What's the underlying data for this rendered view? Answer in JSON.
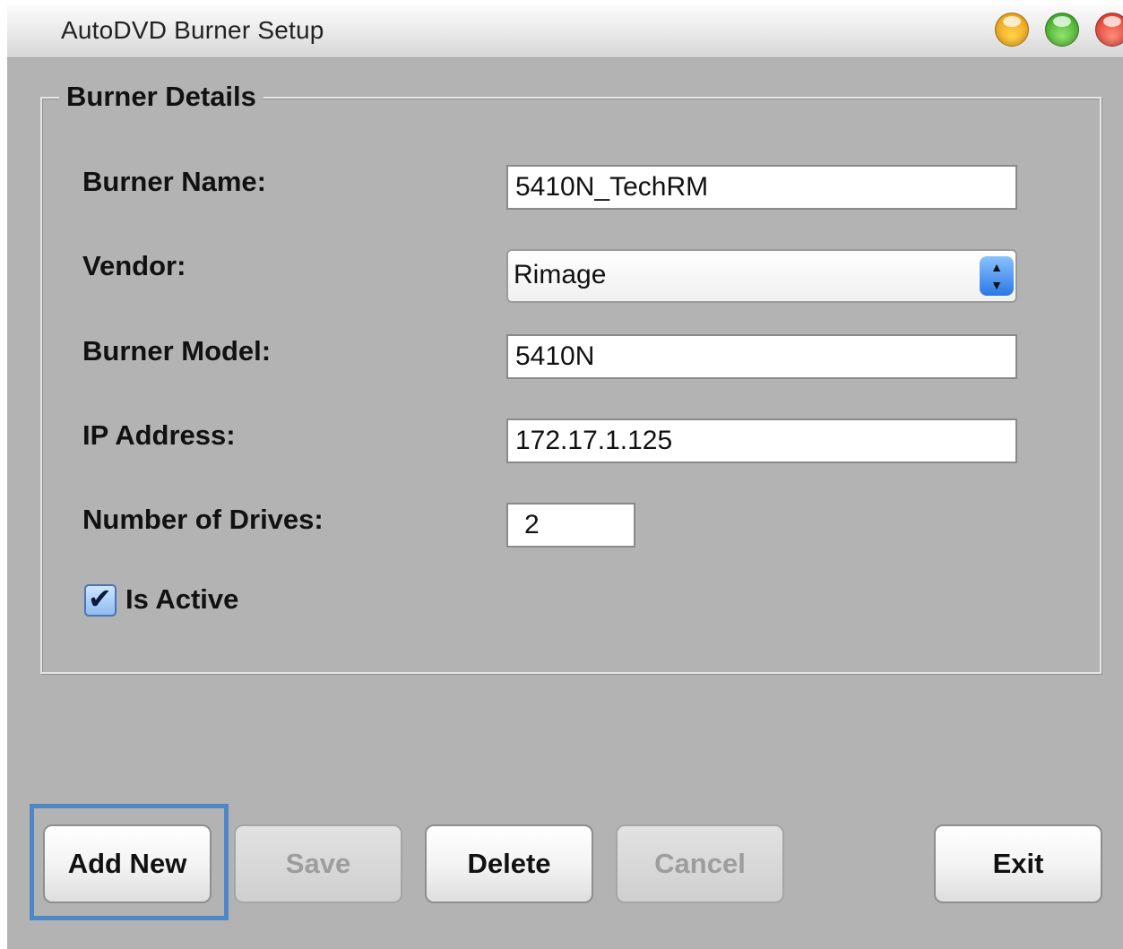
{
  "window": {
    "title": "AutoDVD Burner Setup",
    "controls": [
      "minimize-light",
      "zoom-light",
      "close-light"
    ]
  },
  "group": {
    "title": "Burner Details",
    "fields": {
      "burner_name": {
        "label": "Burner Name:",
        "value": "5410N_TechRM"
      },
      "vendor": {
        "label": "Vendor:",
        "value": "Rimage"
      },
      "burner_model": {
        "label": "Burner Model:",
        "value": "5410N"
      },
      "ip_address": {
        "label": "IP Address:",
        "value": "172.17.1.125"
      },
      "number_of_drives": {
        "label": "Number of Drives:",
        "value": "2"
      }
    },
    "is_active": {
      "label": "Is Active",
      "checked": true
    }
  },
  "buttons": {
    "add_new": "Add New",
    "save": "Save",
    "delete": "Delete",
    "cancel": "Cancel",
    "exit": "Exit"
  },
  "icons": {
    "select_up": "▲",
    "select_down": "▼",
    "check": "✔"
  }
}
